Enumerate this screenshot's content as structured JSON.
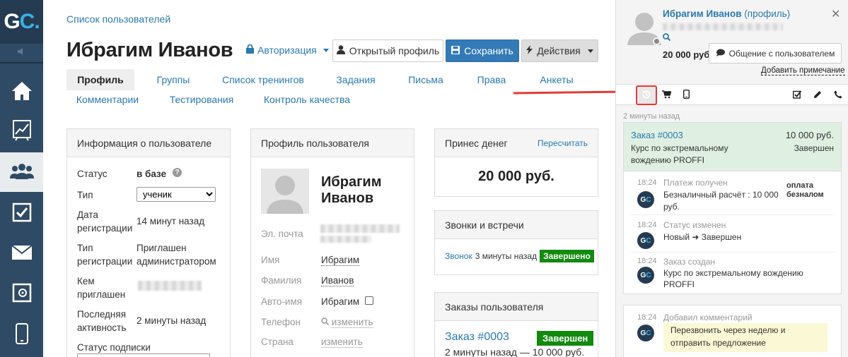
{
  "sidebar": {
    "logo_g": "G",
    "logo_c": "C",
    "logo_dot": ".",
    "items": [
      {
        "name": "home"
      },
      {
        "name": "analytics"
      },
      {
        "name": "users"
      },
      {
        "name": "tasks"
      },
      {
        "name": "mail"
      },
      {
        "name": "safe"
      },
      {
        "name": "mobile"
      }
    ]
  },
  "header": {
    "breadcrumb": "Список пользователей",
    "title": "Ибрагим Иванов",
    "auth_link": "Авторизация",
    "open_profile": "Открытый профиль",
    "save": "Сохранить",
    "actions": "Действия"
  },
  "tabs": [
    {
      "label": "Профиль",
      "active": true
    },
    {
      "label": "Группы"
    },
    {
      "label": "Список тренингов"
    },
    {
      "label": "Задания"
    },
    {
      "label": "Письма"
    },
    {
      "label": "Права"
    },
    {
      "label": "Анкеты"
    },
    {
      "label": "Комментарии"
    },
    {
      "label": "Тестирования"
    },
    {
      "label": "Контроль качества"
    }
  ],
  "user_info": {
    "title": "Информация о пользователе",
    "status_label": "Статус",
    "status_value": "в базе",
    "type_label": "Тип",
    "type_value": "ученик",
    "reg_date_label1": "Дата",
    "reg_date_label2": "регистрации",
    "reg_date_value": "14 минут назад",
    "reg_type_label1": "Тип",
    "reg_type_label2": "регистрации",
    "reg_type_value1": "Приглашен",
    "reg_type_value2": "администратором",
    "invited_label1": "Кем",
    "invited_label2": "приглашен",
    "last_activity_label1": "Последняя",
    "last_activity_label2": "активность",
    "last_activity_value": "2 минуты назад",
    "subscription_label": "Статус подписки"
  },
  "user_profile": {
    "title": "Профиль пользователя",
    "name1": "Ибрагим",
    "name2": "Иванов",
    "email_label": "Эл. почта",
    "first_name_label": "Имя",
    "first_name_value": "Ибрагим",
    "last_name_label": "Фамилия",
    "last_name_value": "Иванов",
    "autoname_label": "Авто-имя",
    "autoname_value": "Ибрагим",
    "phone_label": "Телефон",
    "phone_value": "изменить",
    "country_label": "Страна",
    "country_value": "изменить"
  },
  "money": {
    "title": "Принес денег",
    "recalc": "Пересчитать",
    "amount": "20 000 руб."
  },
  "calls": {
    "title": "Звонки и встречи",
    "call_link": "Звонок",
    "call_time": "3 минуты назад",
    "call_status": "Завершено"
  },
  "orders": {
    "title": "Заказы пользователя",
    "order_link": "Заказ #0003",
    "order_status": "Завершен",
    "order_meta": "2 минуты назад — 10 000 руб."
  },
  "right_panel": {
    "name": "Ибрагим Иванов",
    "profile_link": "(профиль)",
    "amount": "20 000 руб.",
    "chat_button": "Общение с пользователем",
    "add_note": "Добавить примечание",
    "time_ago": "2 минуты назад",
    "order": {
      "link": "Заказ #0003",
      "amount": "10 000 руб.",
      "desc1": "Курс по экстремальному",
      "desc2": "вождению PROFFI",
      "status": "Завершен"
    },
    "events": [
      {
        "time": "18:24",
        "title": "Платеж получен",
        "line1": "Безналичный расчёт : 10 000",
        "line2": "руб.",
        "tag1": "оплата",
        "tag2": "безналом"
      },
      {
        "time": "18:24",
        "title": "Статус изменен",
        "line1": "Новый ➜ Завершен"
      },
      {
        "time": "18:24",
        "title": "Заказ создан",
        "line1": "Курс по экстремальному вождению",
        "line2": "PROFFI"
      }
    ],
    "comment": {
      "time": "18:24",
      "title": "Добавил комментарий",
      "line1": "Перезвонить через неделю и",
      "line2": "отправить предложение"
    }
  },
  "colors": {
    "nav_bg": "#2f4a65",
    "primary": "#337ab7",
    "link": "#2a7ab0",
    "success": "#118a0e",
    "highlight_red": "#e53935",
    "order_bg": "#dff0e2",
    "comment_bg": "#fbf8d5"
  }
}
